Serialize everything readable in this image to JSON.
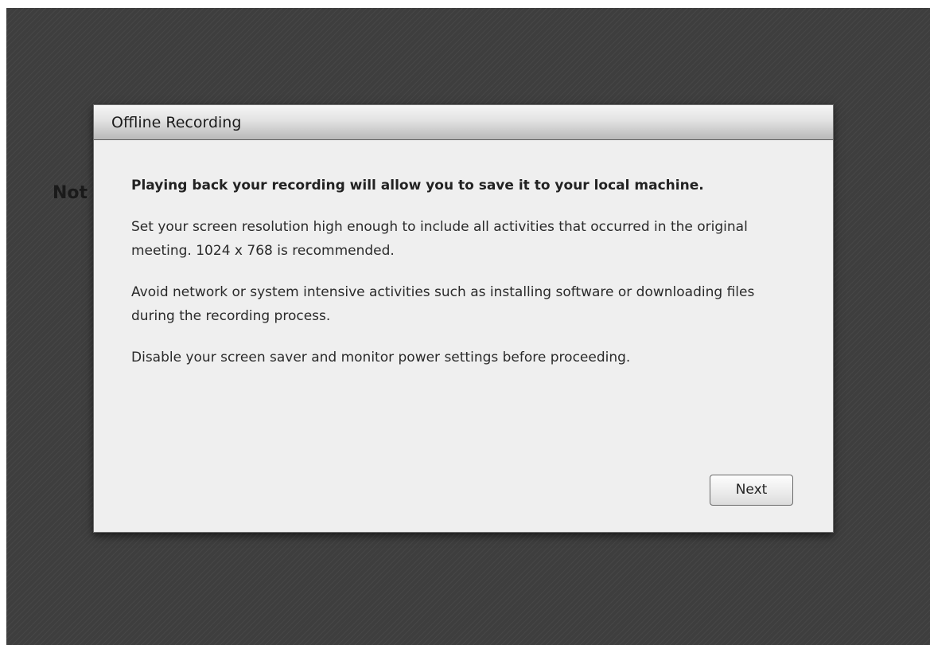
{
  "background": {
    "partial_text": "Not"
  },
  "dialog": {
    "title": "Offline Recording",
    "lead": "Playing back your recording will allow you to save it to your local machine.",
    "paragraphs": [
      "Set your screen resolution high enough to include all activities that occurred in the original meeting. 1024 x 768 is recommended.",
      "Avoid network or system intensive activities such as installing software or downloading files during the recording process.",
      "Disable your screen saver and monitor power settings before proceeding."
    ],
    "next_label": "Next"
  },
  "colors": {
    "backdrop": "#3e3e3e",
    "dialog_background": "#efefef",
    "titlebar_top": "#f6f6f6",
    "titlebar_bottom": "#b9b9b9"
  }
}
